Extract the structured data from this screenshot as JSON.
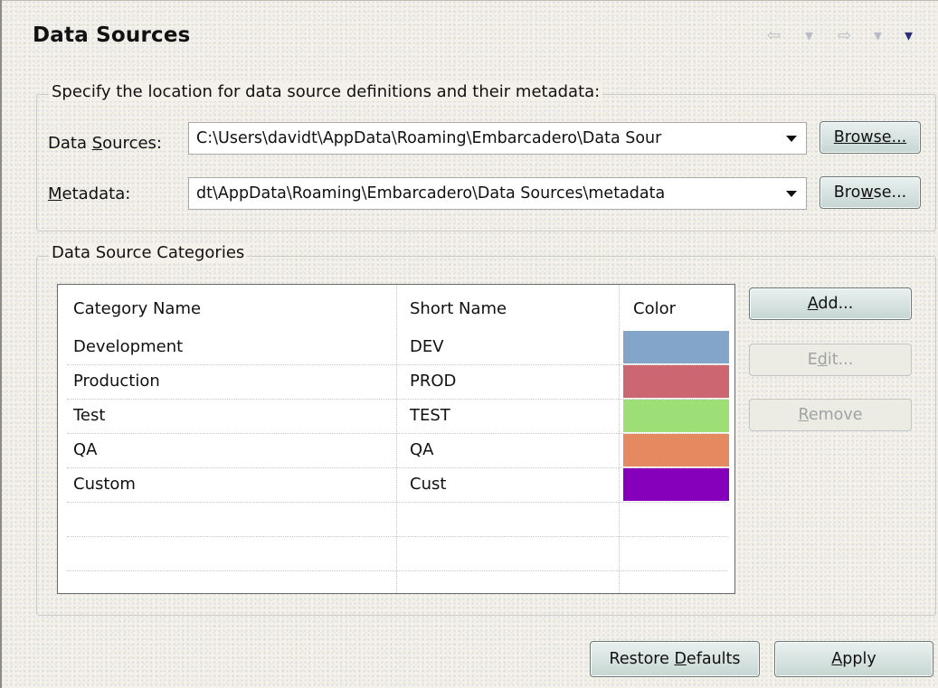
{
  "page": {
    "title": "Data Sources",
    "nav": {
      "back": "⇦",
      "back_menu": "▾",
      "forward": "⇨",
      "forward_menu": "▾",
      "view_menu": "▾"
    }
  },
  "locations": {
    "description": "Specify the location for data source definitions and their metadata:",
    "data_sources": {
      "label_mnemonic": "S",
      "label_pre": "Data ",
      "label_post": "ources:",
      "value": "C:\\Users\\davidt\\AppData\\Roaming\\Embarcadero\\Data Sour",
      "browse_pre": "Browse...",
      "browse_label": "Browse..."
    },
    "metadata": {
      "label_mnemonic": "M",
      "label_post": "etadata:",
      "value": "dt\\AppData\\Roaming\\Embarcadero\\Data Sources\\metadata",
      "browse_a": "Bro",
      "browse_mnemonic": "w",
      "browse_b": "se..."
    }
  },
  "categories": {
    "legend": "Data Source Categories",
    "columns": [
      "Category Name",
      "Short Name",
      "Color"
    ],
    "rows": [
      {
        "name": "Development",
        "short": "DEV",
        "color": "#82a5c9"
      },
      {
        "name": "Production",
        "short": "PROD",
        "color": "#cc6670"
      },
      {
        "name": "Test",
        "short": "TEST",
        "color": "#9dde76"
      },
      {
        "name": "QA",
        "short": "QA",
        "color": "#e58a60"
      },
      {
        "name": "Custom",
        "short": "Cust",
        "color": "#8600bc"
      }
    ],
    "buttons": {
      "add_mnemonic": "A",
      "add_rest": "dd...",
      "edit_a": "E",
      "edit_mnemonic": "d",
      "edit_b": "it...",
      "remove_mnemonic": "R",
      "remove_rest": "emove"
    }
  },
  "footer": {
    "restore_a": "Restore ",
    "restore_mnemonic": "D",
    "restore_b": "efaults",
    "apply_mnemonic": "A",
    "apply_rest": "pply"
  }
}
